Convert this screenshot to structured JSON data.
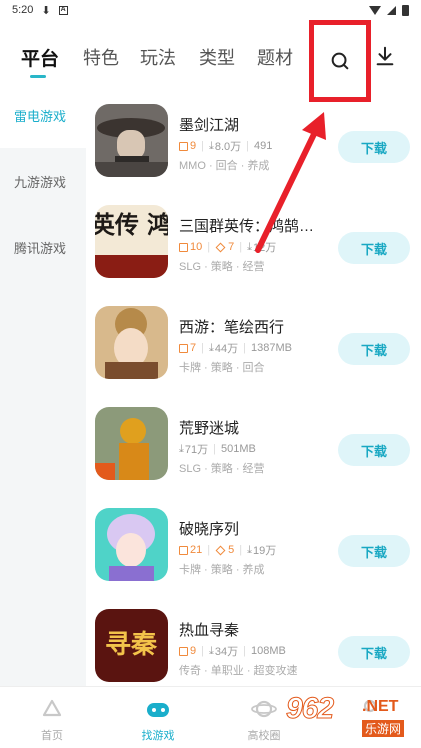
{
  "status_bar": {
    "time": "5:20"
  },
  "tabs": [
    {
      "label": "平台"
    },
    {
      "label": "特色"
    },
    {
      "label": "玩法"
    },
    {
      "label": "类型"
    },
    {
      "label": "题材"
    }
  ],
  "sidebar": {
    "items": [
      {
        "label": "雷电游戏"
      },
      {
        "label": "九游游戏"
      },
      {
        "label": "腾讯游戏"
      }
    ]
  },
  "games": [
    {
      "name": "墨剑江湖",
      "gift": "9",
      "downloads": "8.0万",
      "size": "491",
      "tags": "MMO · 回合 · 养成",
      "button": "下载"
    },
    {
      "name": "三国群英传：鸿鹄…",
      "gift": "10",
      "coupon": "7",
      "downloads": "12万",
      "tags": "SLG · 策略 · 经营",
      "button": "下载"
    },
    {
      "name": "西游：笔绘西行",
      "gift": "7",
      "downloads": "44万",
      "size": "1387MB",
      "tags": "卡牌 · 策略 · 回合",
      "button": "下载"
    },
    {
      "name": "荒野迷城",
      "downloads": "71万",
      "size": "501MB",
      "tags": "SLG · 策略 · 经营",
      "button": "下载"
    },
    {
      "name": "破晓序列",
      "gift": "21",
      "coupon": "5",
      "downloads": "19万",
      "tags": "卡牌 · 策略 · 养成",
      "button": "下载"
    },
    {
      "name": "热血寻秦",
      "gift": "9",
      "downloads": "34万",
      "size": "108MB",
      "tags": "传奇 · 单职业 · 超变攻速",
      "button": "下载"
    }
  ],
  "icons": {
    "game_1": "墨剑江湖",
    "game_2": "三国群英传 鸿鹄霸业",
    "game_4": "荒野迷城",
    "game_6": "寻秦"
  },
  "bottom_nav": [
    {
      "label": "首页"
    },
    {
      "label": "找游戏"
    },
    {
      "label": "高校圈"
    },
    {
      "label": ""
    }
  ],
  "watermark": {
    "logo": "962",
    "net": ".NET",
    "cn": "乐游网"
  },
  "colors": {
    "accent": "#1aaecb",
    "highlight": "#e8202a",
    "gift": "#f08a3c"
  }
}
